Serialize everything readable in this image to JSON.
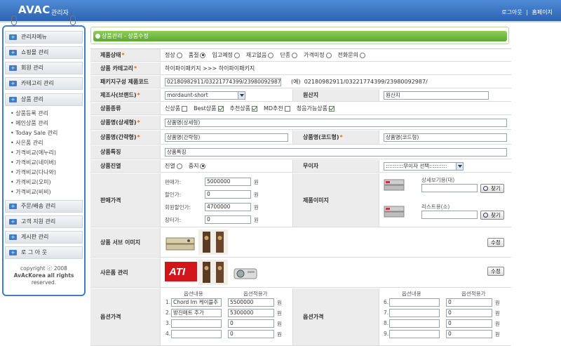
{
  "header": {
    "logo": "AVAC",
    "logo_sub": "관리자",
    "links": [
      "로그아웃",
      "홈페이지"
    ],
    "link_sep": "|"
  },
  "sidebar": {
    "menu": [
      {
        "label": "관리자메뉴"
      },
      {
        "label": "쇼핑몰 관리"
      },
      {
        "label": "회원 관리"
      },
      {
        "label": "카테고리 관리"
      },
      {
        "label": "상품 관리"
      }
    ],
    "submenu": [
      "상품등록 관리",
      "메인상품 관리",
      "Today Sale 관리",
      "사은품 관리",
      "가격비교(에누리)",
      "가격비교(네이버)",
      "가격비교(다나와)",
      "가격비교(오미)",
      "가격비교(비비)"
    ],
    "menu_bottom": [
      {
        "label": "주문/배송 관리"
      },
      {
        "label": "고객 지원 관리"
      },
      {
        "label": "게시판 관리"
      },
      {
        "label": "로 그 아 웃"
      }
    ],
    "copyright_lines": [
      "copyright ⓒ 2008",
      "AvAcKorea all rights",
      "reserved."
    ]
  },
  "page_title": "상품관리 - 상품수정",
  "form": {
    "status": {
      "label": "제품상태",
      "options": [
        "정상",
        "품절",
        "입고예정",
        "재고없음",
        "단종",
        "가격미정",
        "전화문의"
      ],
      "selected": "입고예정"
    },
    "category": {
      "label": "상품 카테고리",
      "value": "하이파이패키지  >>>  하이파이패키지"
    },
    "package_code": {
      "label": "패키지구성 제품코드",
      "value": "02180982911/03221774399/23980092987/",
      "example_label": "(예)",
      "example": "02180982911/03221774399/23980092987/"
    },
    "manufacturer": {
      "label": "제조사(브랜드)",
      "value": "mordaunt-short"
    },
    "origin": {
      "label": "원산지",
      "value": "원산지"
    },
    "product_type": {
      "label": "상품종류",
      "options": [
        {
          "label": "신상품",
          "checked": false
        },
        {
          "label": "Best상품",
          "checked": true
        },
        {
          "label": "추천상품",
          "checked": true
        },
        {
          "label": "MD추천",
          "checked": false
        },
        {
          "label": "청음가능상품",
          "checked": true
        }
      ]
    },
    "name_detail": {
      "label": "상품명(상세형)",
      "value": "상품명(상세형)"
    },
    "name_short": {
      "label": "상품명(간략형)",
      "value": "상품명(간략형)"
    },
    "name_code": {
      "label": "상품명(코드형)",
      "value": "상품명(코드형)"
    },
    "feature": {
      "label": "상품특징",
      "value": "상품특징"
    },
    "display": {
      "label": "상품진열",
      "options": [
        "진열",
        "중지"
      ],
      "selected": "중지"
    },
    "gift": {
      "label": "무이자",
      "value": "::::::::::무이자 선택::::::::::"
    },
    "price": {
      "label": "판매가격",
      "rows": [
        {
          "label": "판매가:",
          "value": "5000000",
          "unit": "원"
        },
        {
          "label": "할인가:",
          "value": "0",
          "unit": "원"
        },
        {
          "label": "회원할인가:",
          "value": "4700000",
          "unit": "원"
        },
        {
          "label": "장터가:",
          "value": "0",
          "unit": "원"
        }
      ]
    },
    "product_image": {
      "label": "제품이미지",
      "detail_label": "상세보기용(대)",
      "list_label": "리스트용(소)",
      "browse": "찾기"
    },
    "sub_image": {
      "label": "상품 서브 이미지",
      "edit": "수정"
    },
    "gift_manage": {
      "label": "사은품 관리",
      "edit": "수정"
    },
    "options_price": {
      "label": "옵션가격",
      "col_content": "옵션내용",
      "col_price": "옵션적용가",
      "left": [
        {
          "no": "1.",
          "content": "Chord Im 케이블추",
          "price": "5500000",
          "unit": "원"
        },
        {
          "no": "2.",
          "content": "방진매트 추가",
          "price": "5300000",
          "unit": "원"
        },
        {
          "no": "3.",
          "content": "",
          "price": "0",
          "unit": "원"
        },
        {
          "no": "4.",
          "content": "",
          "price": "0",
          "unit": "원"
        }
      ],
      "right": [
        {
          "no": "6.",
          "content": "",
          "price": "0",
          "unit": "원"
        },
        {
          "no": "7.",
          "content": "",
          "price": "0",
          "unit": "원"
        },
        {
          "no": "8.",
          "content": "",
          "price": "0",
          "unit": "원"
        },
        {
          "no": "9.",
          "content": "",
          "price": "0",
          "unit": "원"
        }
      ]
    }
  }
}
